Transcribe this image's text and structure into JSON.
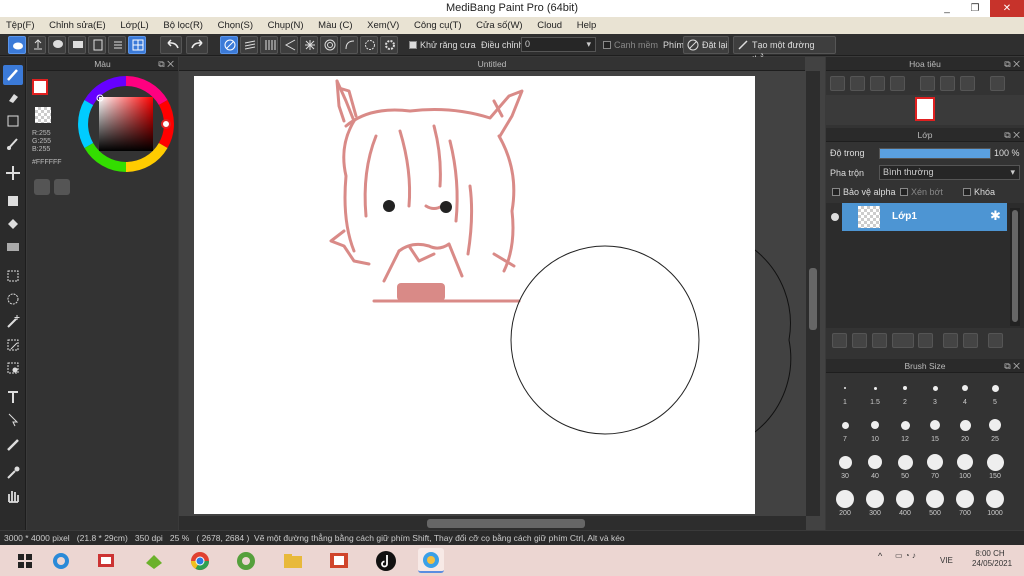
{
  "window": {
    "title": "MediBang Paint Pro (64bit)",
    "minimize": "_",
    "maximize": "❐",
    "close": "✕"
  },
  "menu": [
    "Tệp(F)",
    "Chỉnh sửa(E)",
    "Lớp(L)",
    "Bộ lọc(R)",
    "Chọn(S)",
    "Chụp(N)",
    "Màu (C)",
    "Xem(V)",
    "Công cụ(T)",
    "Cửa số(W)",
    "Cloud",
    "Help"
  ],
  "toolbar": {
    "antialias_label": "Khử răng cưa",
    "correction_label": "Điều chỉnh",
    "correction_value": "0",
    "snap_edge_label": "Canh mềm",
    "pen_label": "Phím",
    "reset_label": "Đặt lại",
    "straight_line_label": "Tạo một đường thẳng"
  },
  "color_panel": {
    "title": "Màu",
    "rgb_r": "R:255",
    "rgb_g": "G:255",
    "rgb_b": "B:255",
    "hex": "#FFFFFF",
    "fg_color": "#ffffff",
    "accent_border": "#e02020"
  },
  "document": {
    "tab_title": "Untitled"
  },
  "navigator": {
    "title": "Hoa tiêu"
  },
  "layers": {
    "title": "Lớp",
    "opacity_label": "Độ trong",
    "opacity_value": "100 %",
    "opacity_fraction": 1.0,
    "blend_label": "Pha trộn",
    "blend_value": "Bình thường",
    "protect_alpha_label": "Bảo vệ alpha",
    "clipping_label": "Xén bớt",
    "lock_label": "Khóa",
    "layer_name": "Lớp1"
  },
  "brush_size": {
    "title": "Brush Size",
    "sizes": [
      "1",
      "1.5",
      "2",
      "3",
      "4",
      "5",
      "7",
      "10",
      "12",
      "15",
      "20",
      "25",
      "30",
      "40",
      "50",
      "70",
      "100",
      "150",
      "200",
      "300",
      "400",
      "500",
      "700",
      "1000"
    ]
  },
  "status": {
    "size": "3000 * 4000 pixel",
    "cm": "(21.8 * 29cm)",
    "dpi": "350 dpi",
    "zoom": "25 %",
    "coords": "( 2678, 2684 )",
    "hint": "Vẽ một đường thẳng bằng cách giữ phím Shift, Thay đổi cỡ cọ bằng cách giữ phím Ctrl, Alt và kéo"
  },
  "taskbar": {
    "chevron": "^",
    "lang": "VIE",
    "time": "8:00 CH",
    "date": "24/05/2021"
  },
  "colors": {
    "accent": "#3b7ad8",
    "layer_selected": "#4d95d3",
    "sketch": "#d98a87",
    "taskbar": "#ecd6d2"
  }
}
